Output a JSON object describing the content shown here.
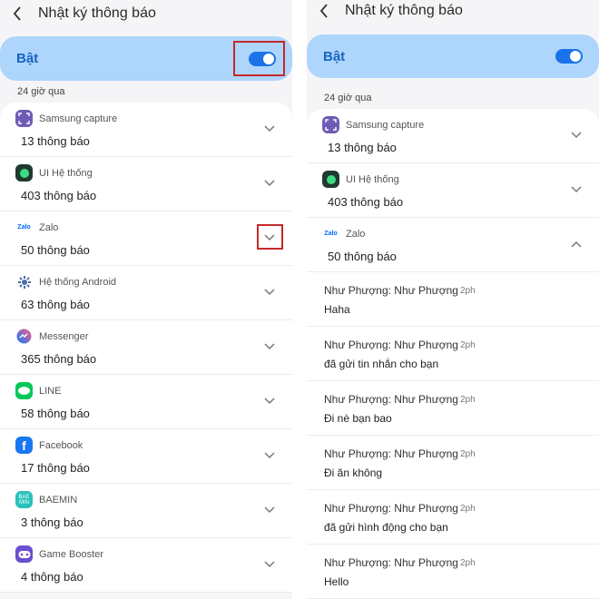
{
  "screen_title": "Nhật ký thông báo",
  "toggle_label": "Bật",
  "section_label": "24 giờ qua",
  "left_apps": [
    {
      "name": "Samsung capture",
      "count": "13 thông báo",
      "icon": "samsung-capture-icon",
      "color": "#6f5bb5"
    },
    {
      "name": "UI Hệ thống",
      "count": "403 thông báo",
      "icon": "system-ui-icon",
      "color": "#2e7d5b"
    },
    {
      "name": "Zalo",
      "count": "50 thông báo",
      "icon": "zalo-icon",
      "color": "#0068ff"
    },
    {
      "name": "Hệ thống Android",
      "count": "63 thông báo",
      "icon": "android-system-icon",
      "color": "#4a6fa5"
    },
    {
      "name": "Messenger",
      "count": "365 thông báo",
      "icon": "messenger-icon",
      "color": "#8a3ffc"
    },
    {
      "name": "LINE",
      "count": "58 thông báo",
      "icon": "line-icon",
      "color": "#06c755"
    },
    {
      "name": "Facebook",
      "count": "17 thông báo",
      "icon": "facebook-icon",
      "color": "#1877f2"
    },
    {
      "name": "BAEMIN",
      "count": "3 thông báo",
      "icon": "baemin-icon",
      "color": "#2ac1bc"
    },
    {
      "name": "Game Booster",
      "count": "4 thông báo",
      "icon": "game-booster-icon",
      "color": "#6a4fcf"
    }
  ],
  "right_apps": [
    {
      "name": "Samsung capture",
      "count": "13 thông báo",
      "icon": "samsung-capture-icon",
      "color": "#6f5bb5"
    },
    {
      "name": "UI Hệ thống",
      "count": "403 thông báo",
      "icon": "system-ui-icon",
      "color": "#2e7d5b"
    },
    {
      "name": "Zalo",
      "count": "50 thông báo",
      "icon": "zalo-icon",
      "color": "#0068ff"
    }
  ],
  "zalo_icon_text": "Zalo",
  "baemin_icon_text": "BAE MIN",
  "messages": [
    {
      "sender": "Như Phượng: Như Phượng",
      "time": "2ph",
      "text": "Haha"
    },
    {
      "sender": "Như Phượng: Như Phượng",
      "time": "2ph",
      "text": "đã gửi tin nhắn cho bạn"
    },
    {
      "sender": "Như Phượng: Như Phượng",
      "time": "2ph",
      "text": "Đi nè bạn bao"
    },
    {
      "sender": "Như Phượng: Như Phượng",
      "time": "2ph",
      "text": "Đi ăn không"
    },
    {
      "sender": "Như Phượng: Như Phượng",
      "time": "2ph",
      "text": "đã gửi hình động cho bạn"
    },
    {
      "sender": "Như Phượng: Như Phượng",
      "time": "2ph",
      "text": "Hello"
    }
  ],
  "colors": {
    "accent": "#1a73e8",
    "toggle_bg": "#aed5fb",
    "highlight": "#c62828",
    "panel_bg": "#f5f5f7"
  }
}
